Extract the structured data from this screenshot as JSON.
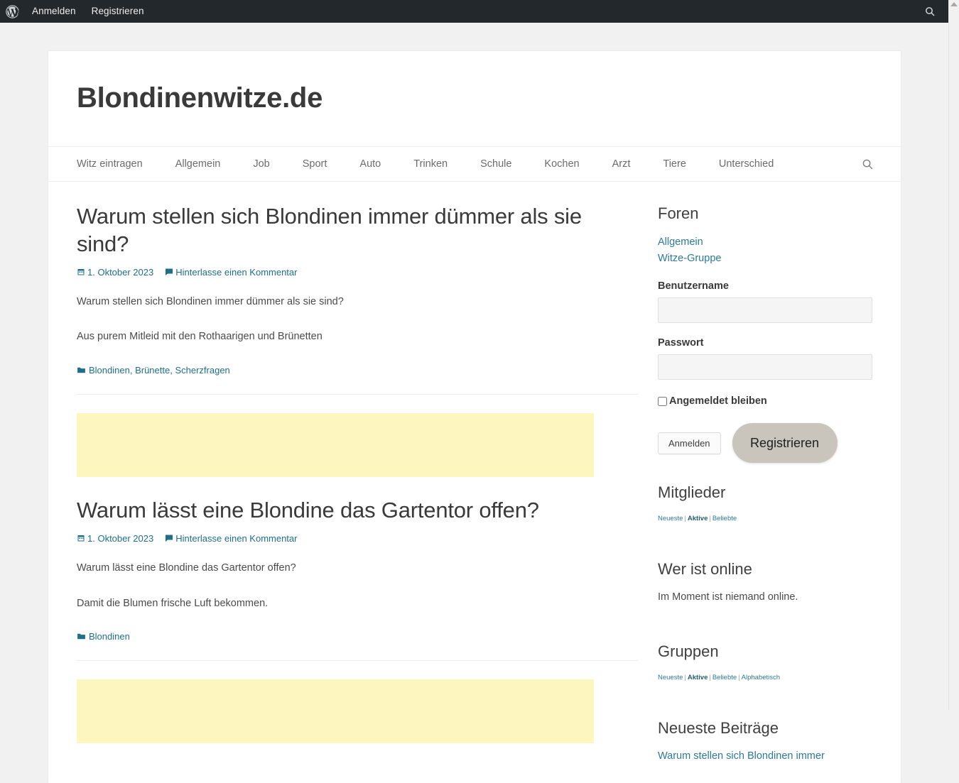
{
  "adminbar": {
    "logo_icon": "wordpress-logo-icon",
    "links": [
      {
        "label": "Anmelden"
      },
      {
        "label": "Registrieren"
      }
    ],
    "search_icon": "search-icon"
  },
  "scrollbar": {
    "arrow_up_icon": "scroll-up-arrow-icon"
  },
  "header": {
    "site_title": "Blondinenwitze.de"
  },
  "nav": {
    "items": [
      {
        "label": "Witz eintragen"
      },
      {
        "label": "Allgemein"
      },
      {
        "label": "Job"
      },
      {
        "label": "Sport"
      },
      {
        "label": "Auto"
      },
      {
        "label": "Trinken"
      },
      {
        "label": "Schule"
      },
      {
        "label": "Kochen"
      },
      {
        "label": "Arzt"
      },
      {
        "label": "Tiere"
      },
      {
        "label": "Unterschied"
      }
    ],
    "search_toggle_icon": "search-icon"
  },
  "posts": [
    {
      "title": "Warum stellen sich Blondinen immer dümmer als sie sind?",
      "date": "1. Oktober 2023",
      "date_icon": "calendar-icon",
      "comment_label": "Hinterlasse einen Kommentar",
      "comment_icon": "comment-bubble-icon",
      "body": [
        "Warum stellen sich Blondinen immer dümmer als sie sind?",
        "Aus purem Mitleid mit den Rothaarigen und Brünetten"
      ],
      "category_icon": "folder-icon",
      "categories": [
        "Blondinen",
        "Brünette",
        "Scherzfragen"
      ]
    },
    {
      "title": "Warum lässt eine Blondine das Gartentor offen?",
      "date": "1. Oktober 2023",
      "date_icon": "calendar-icon",
      "comment_label": "Hinterlasse einen Kommentar",
      "comment_icon": "comment-bubble-icon",
      "body": [
        "Warum lässt eine Blondine das Gartentor offen?",
        "Damit die Blumen frische Luft bekommen."
      ],
      "category_icon": "folder-icon",
      "categories": [
        "Blondinen"
      ]
    }
  ],
  "ads": {
    "placeholder_color": "#fdf6bf"
  },
  "sidebar": {
    "forums": {
      "title": "Foren",
      "links": [
        {
          "label": "Allgemein"
        },
        {
          "label": "Witze-Gruppe"
        }
      ]
    },
    "login": {
      "username_label": "Benutzername",
      "username_value": "",
      "username_placeholder": "",
      "password_label": "Passwort",
      "password_value": "",
      "password_placeholder": "",
      "remember_label": "Angemeldet bleiben",
      "remember_checked": false,
      "login_button": "Anmelden",
      "register_button": "Registrieren"
    },
    "members": {
      "title": "Mitglieder",
      "tabs": [
        {
          "label": "Neueste",
          "active": false
        },
        {
          "label": "Aktive",
          "active": true
        },
        {
          "label": "Beliebte",
          "active": false
        }
      ]
    },
    "online": {
      "title": "Wer ist online",
      "text": "Im Moment ist niemand online."
    },
    "groups": {
      "title": "Gruppen",
      "tabs": [
        {
          "label": "Neueste",
          "active": false
        },
        {
          "label": "Aktive",
          "active": true
        },
        {
          "label": "Beliebte",
          "active": false
        },
        {
          "label": "Alphabetisch",
          "active": false
        }
      ]
    },
    "recent_posts": {
      "title": "Neueste Beiträge",
      "items": [
        {
          "label": "Warum stellen sich Blondinen immer"
        }
      ]
    }
  },
  "colors": {
    "adminbar_bg": "#23282d",
    "page_bg": "#f1f1f1",
    "content_bg": "#ffffff",
    "link": "#2c7a98",
    "heading": "#3a3a3a",
    "ad_yellow": "#fdf6bf",
    "register_btn": "#c9c5bd"
  }
}
